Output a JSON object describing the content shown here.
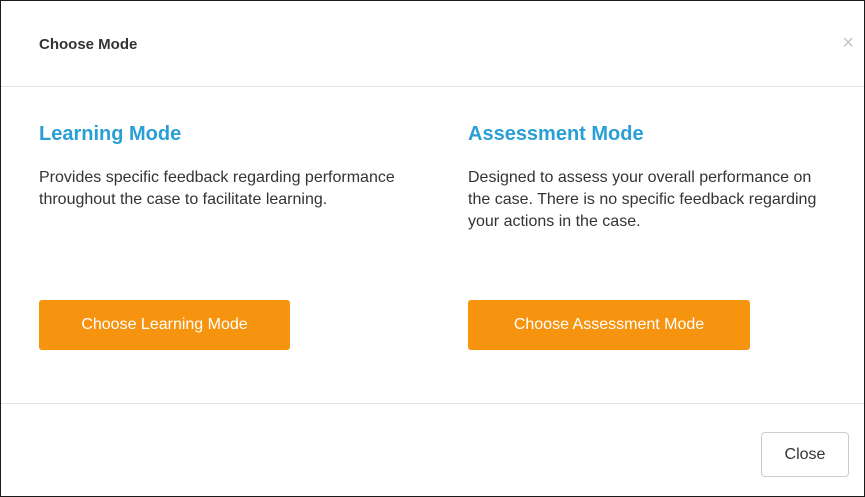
{
  "modal": {
    "title": "Choose Mode",
    "close_x": "×",
    "close_button_label": "Close"
  },
  "modes": [
    {
      "heading": "Learning Mode",
      "description": "Provides specific feedback regarding performance throughout the case to facilitate learning.",
      "button_label": "Choose Learning Mode"
    },
    {
      "heading": "Assessment Mode",
      "description": "Designed to assess your overall perfor­mance on the case. There is no specific feedback regarding your actions in the case.",
      "button_label": "Choose Assessment Mode"
    }
  ],
  "colors": {
    "accent_heading": "#2a9fd6",
    "button_primary": "#f7940f"
  }
}
